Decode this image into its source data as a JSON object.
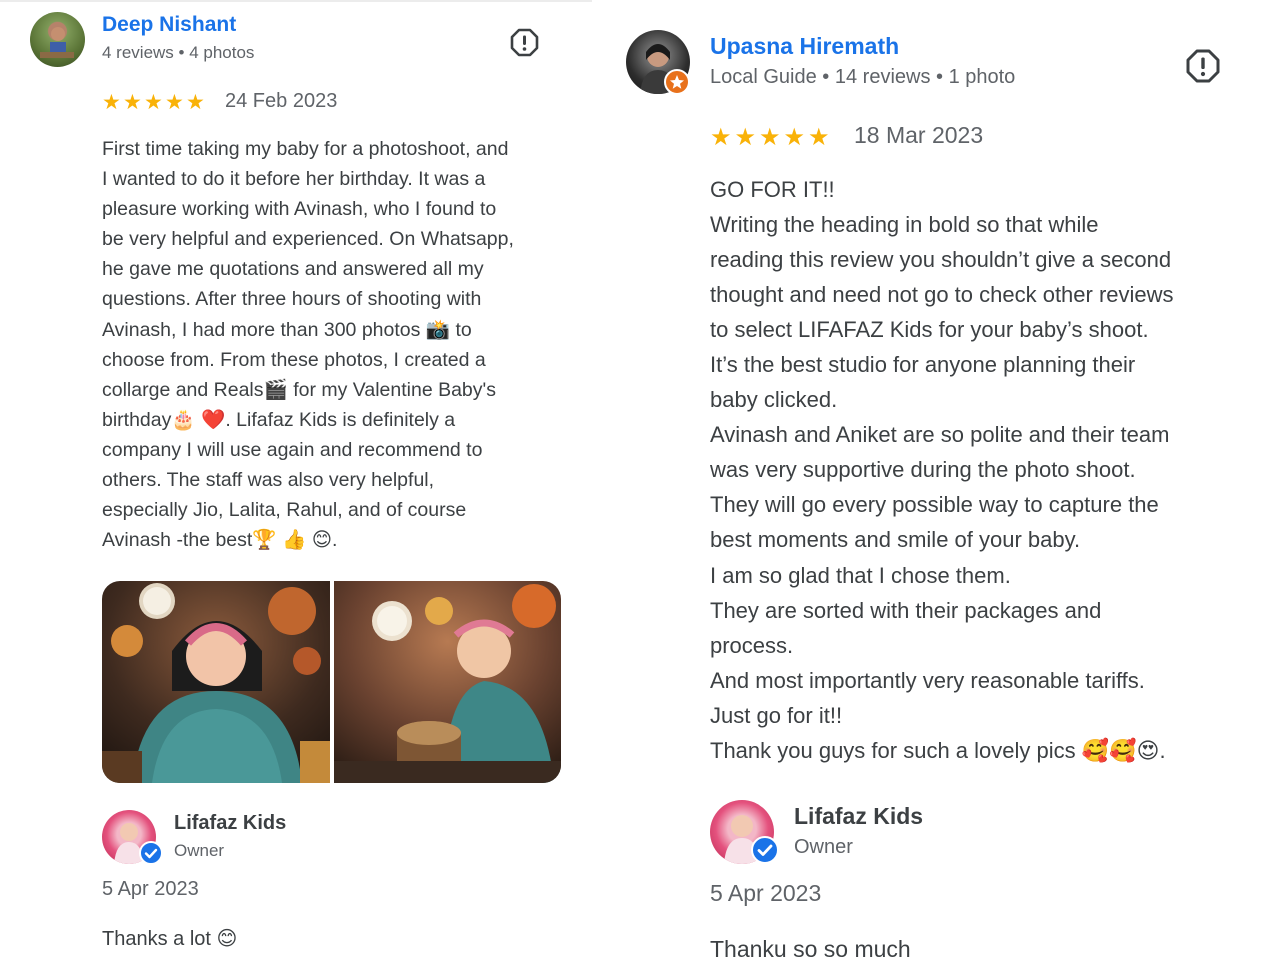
{
  "left_review": {
    "reviewer_name": "Deep Nishant",
    "reviewer_meta": "4 reviews • 4 photos",
    "rating": 5,
    "date": "24 Feb 2023",
    "text_lines": [
      "First time taking my baby for a photoshoot, and",
      "I wanted to do it before her birthday. It was a",
      "pleasure working with Avinash, who I found to",
      "be very helpful and experienced. On Whatsapp,",
      "he gave me quotations and answered all my",
      "questions. After three hours of shooting with",
      "Avinash, I had more than 300 photos 📸 to",
      "choose from. From these photos, I created a",
      "collarge and Reals🎬 for my Valentine Baby's",
      "birthday🎂 ❤️. Lifafaz Kids is definitely a",
      "company I will use again and recommend to",
      "others. The staff was also very helpful,",
      "especially Jio, Lalita, Rahul, and of course",
      "Avinash -the best🏆 👍 😊."
    ],
    "owner_reply": {
      "name": "Lifafaz Kids",
      "role": "Owner",
      "date": "5 Apr 2023",
      "text": "Thanks a lot 😊"
    }
  },
  "right_review": {
    "reviewer_name": "Upasna Hiremath",
    "reviewer_meta": "Local Guide • 14 reviews • 1 photo",
    "rating": 5,
    "date": "18 Mar 2023",
    "text_lines": [
      "GO FOR IT!!",
      "Writing the heading in bold so that while",
      "reading this review you shouldn’t give a second",
      "thought and need not go to check other reviews",
      "to select LIFAFAZ Kids for your baby’s shoot.",
      "It’s the best studio for anyone planning their",
      "baby clicked.",
      "Avinash and Aniket are so polite and their team",
      "was very supportive during the photo shoot.",
      "They will go every possible way to capture the",
      "best moments and smile of your baby.",
      "I am so glad that I chose them.",
      "They are sorted with their packages and",
      "process.",
      "And most importantly very reasonable tariffs.",
      "Just go for it!!",
      "Thank you guys for such a lovely pics 🥰🥰😍."
    ],
    "owner_reply": {
      "name": "Lifafaz Kids",
      "role": "Owner",
      "date": "5 Apr 2023",
      "text": "Thanku so so much"
    }
  },
  "icons": {
    "flag": "report-flag-icon",
    "star": "star-icon",
    "verified": "verified-check-icon",
    "local_guide": "local-guide-badge-icon"
  },
  "colors": {
    "name_blue": "#1a73e8",
    "star_gold": "#f9b208",
    "meta_gray": "#5f6368",
    "text": "#3c4043"
  }
}
